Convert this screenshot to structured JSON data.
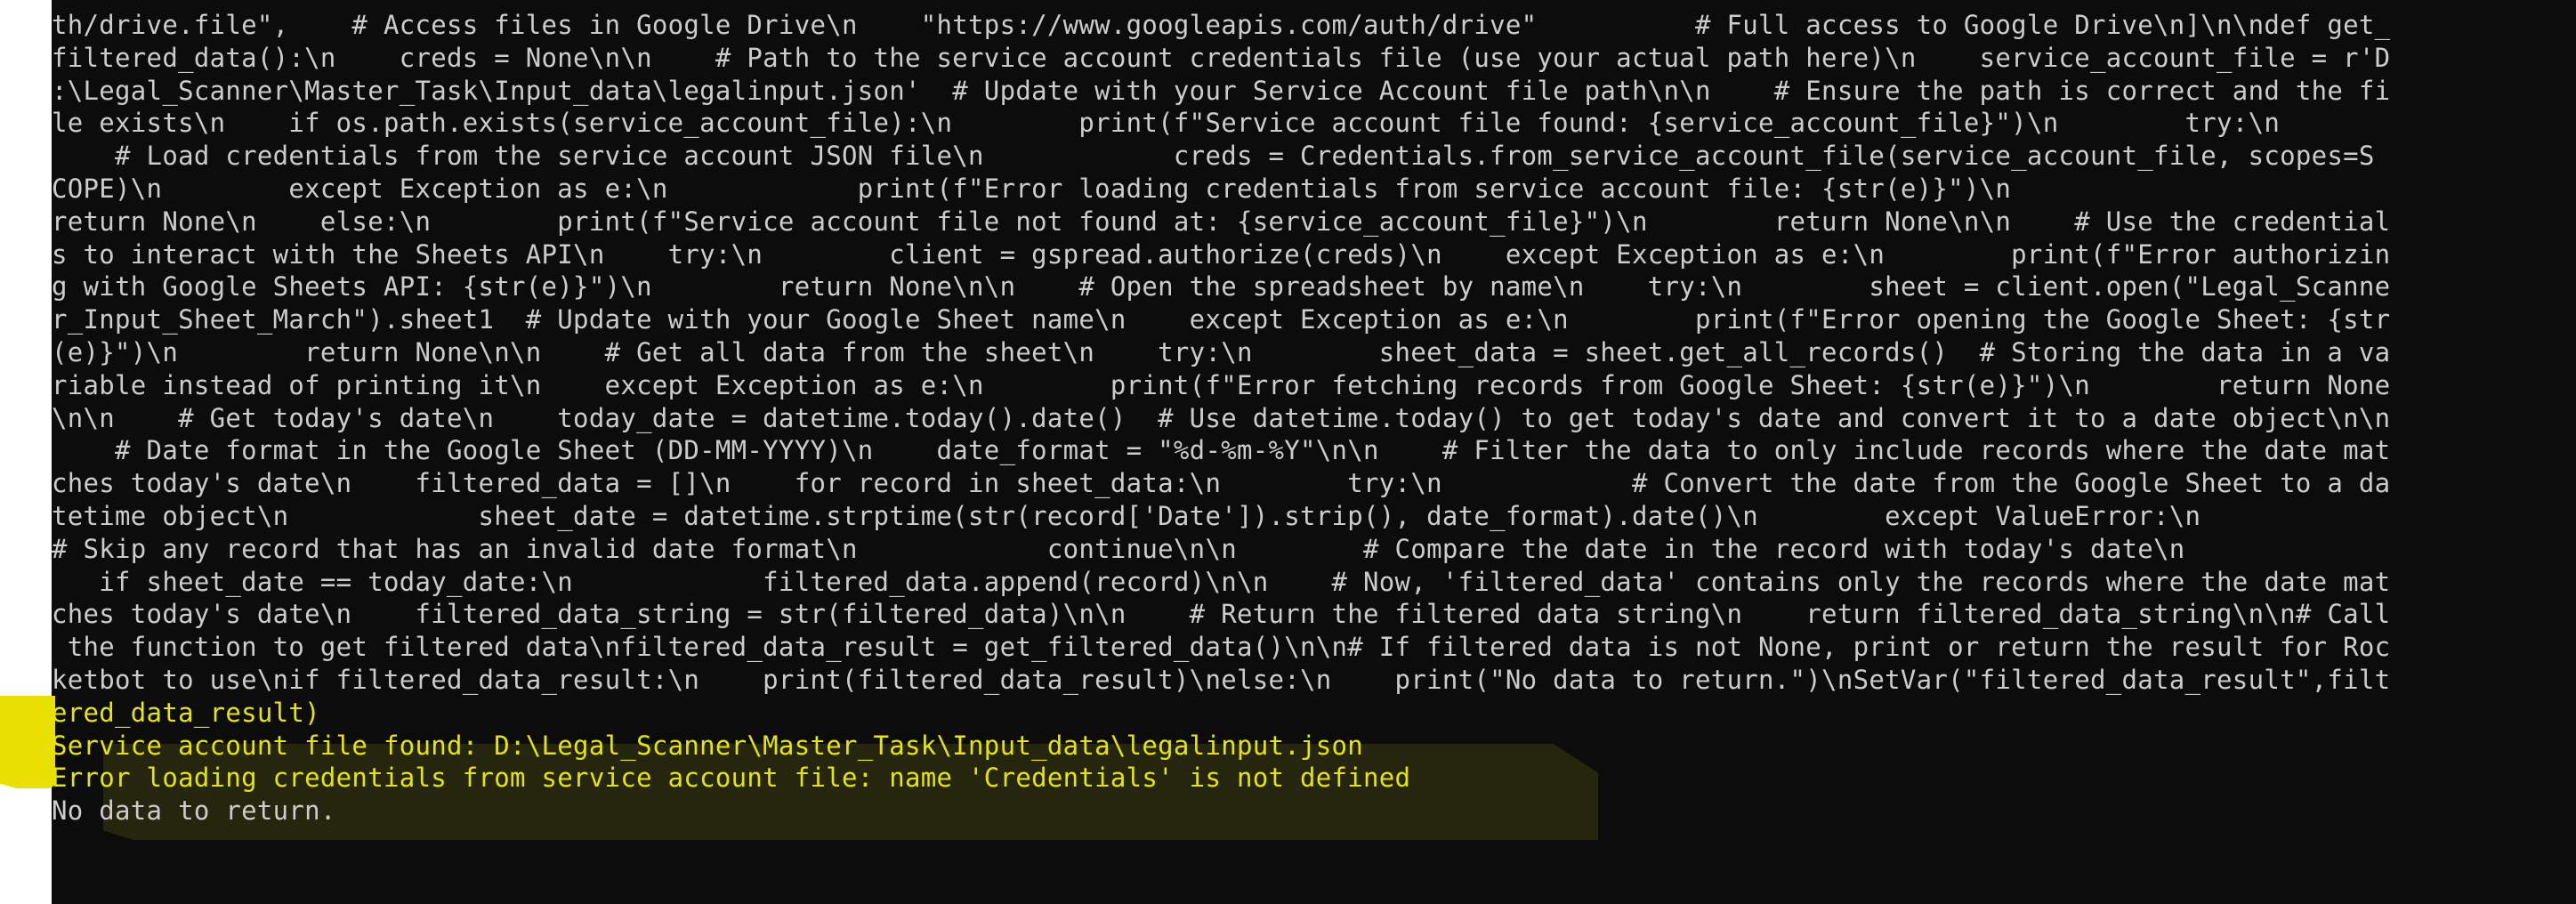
{
  "terminal": {
    "code_lines": [
      "th/drive.file\",    # Access files in Google Drive\\n    \"https://www.googleapis.com/auth/drive\"          # Full access to Google Drive\\n]\\n\\ndef get_",
      "filtered_data():\\n    creds = None\\n\\n    # Path to the service account credentials file (use your actual path here)\\n    service_account_file = r'D",
      ":\\Legal_Scanner\\Master_Task\\Input_data\\legalinput.json'  # Update with your Service Account file path\\n\\n    # Ensure the path is correct and the fi",
      "le exists\\n    if os.path.exists(service_account_file):\\n        print(f\"Service account file found: {service_account_file}\")\\n        try:\\n",
      "    # Load credentials from the service account JSON file\\n            creds = Credentials.from_service_account_file(service_account_file, scopes=S",
      "COPE)\\n        except Exception as e:\\n            print(f\"Error loading credentials from service account file: {str(e)}\")\\n",
      "return None\\n    else:\\n        print(f\"Service account file not found at: {service_account_file}\")\\n        return None\\n\\n    # Use the credential",
      "s to interact with the Sheets API\\n    try:\\n        client = gspread.authorize(creds)\\n    except Exception as e:\\n        print(f\"Error authorizin",
      "g with Google Sheets API: {str(e)}\")\\n        return None\\n\\n    # Open the spreadsheet by name\\n    try:\\n        sheet = client.open(\"Legal_Scanne",
      "r_Input_Sheet_March\").sheet1  # Update with your Google Sheet name\\n    except Exception as e:\\n        print(f\"Error opening the Google Sheet: {str",
      "(e)}\")\\n        return None\\n\\n    # Get all data from the sheet\\n    try:\\n        sheet_data = sheet.get_all_records()  # Storing the data in a va",
      "riable instead of printing it\\n    except Exception as e:\\n        print(f\"Error fetching records from Google Sheet: {str(e)}\")\\n        return None",
      "\\n\\n    # Get today's date\\n    today_date = datetime.today().date()  # Use datetime.today() to get today's date and convert it to a date object\\n\\n",
      "    # Date format in the Google Sheet (DD-MM-YYYY)\\n    date_format = \"%d-%m-%Y\"\\n\\n    # Filter the data to only include records where the date mat",
      "ches today's date\\n    filtered_data = []\\n    for record in sheet_data:\\n        try:\\n            # Convert the date from the Google Sheet to a da",
      "tetime object\\n            sheet_date = datetime.strptime(str(record['Date']).strip(), date_format).date()\\n        except ValueError:\\n",
      "# Skip any record that has an invalid date format\\n            continue\\n\\n        # Compare the date in the record with today's date\\n",
      "   if sheet_date == today_date:\\n            filtered_data.append(record)\\n\\n    # Now, 'filtered_data' contains only the records where the date mat",
      "ches today's date\\n    filtered_data_string = str(filtered_data)\\n\\n    # Return the filtered data string\\n    return filtered_data_string\\n\\n# Call",
      " the function to get filtered data\\nfiltered_data_result = get_filtered_data()\\n\\n# If filtered data is not None, print or return the result for Roc",
      "ketbot to use\\nif filtered_data_result:\\n    print(filtered_data_result)\\nelse:\\n    print(\"No data to return.\")\\nSetVar(\"filtered_data_result\",filt"
    ],
    "output_lines": [
      "ered_data_result)",
      "Service account file found: D:\\Legal_Scanner\\Master_Task\\Input_data\\legalinput.json",
      "Error loading credentials from service account file: name 'Credentials' is not defined"
    ],
    "final_line": "No data to return.",
    "colors": {
      "background": "#0c0c0c",
      "text": "#cccccc",
      "highlight_text": "#e6e600",
      "highlight_marker": "#e8e000"
    }
  }
}
